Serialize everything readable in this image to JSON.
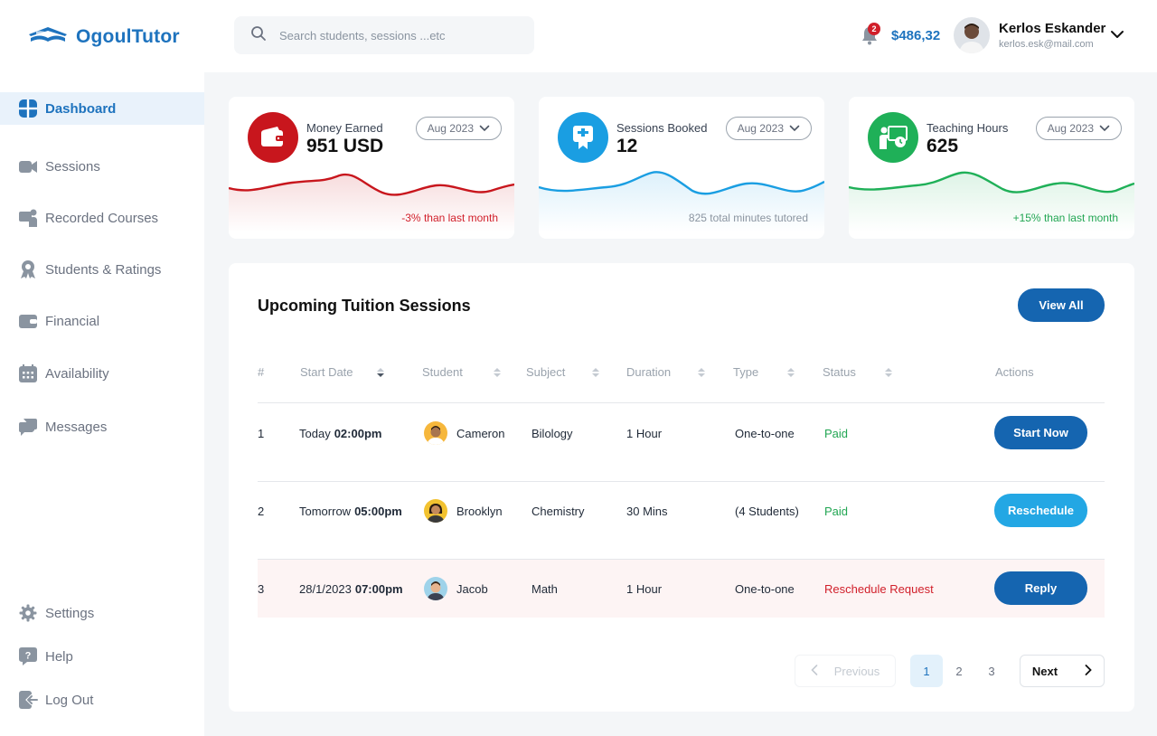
{
  "brand": {
    "name": "OgoulTutor"
  },
  "search": {
    "placeholder": "Search students, sessions ...etc"
  },
  "header": {
    "notifications_count": "2",
    "balance": "$486,32",
    "user_name": "Kerlos Eskander",
    "user_email": "kerlos.esk@mail.com"
  },
  "sidebar": {
    "items": [
      {
        "label": "Dashboard",
        "icon": "dashboard-icon",
        "active": true
      },
      {
        "label": "Sessions",
        "icon": "video-camera-icon"
      },
      {
        "label": "Recorded Courses",
        "icon": "screen-presenter-icon"
      },
      {
        "label": "Students & Ratings",
        "icon": "award-ribbon-icon"
      },
      {
        "label": "Financial",
        "icon": "wallet-icon"
      },
      {
        "label": "Availability",
        "icon": "calendar-icon"
      },
      {
        "label": "Messages",
        "icon": "chat-bubbles-icon"
      }
    ],
    "bottom": [
      {
        "label": "Settings",
        "icon": "gear-icon"
      },
      {
        "label": "Help",
        "icon": "help-icon"
      },
      {
        "label": "Log Out",
        "icon": "logout-icon"
      }
    ]
  },
  "stats": [
    {
      "label": "Money Earned",
      "value": "951 USD",
      "period": "Aug 2023",
      "note": "-3% than last month",
      "color": "#c8161d",
      "note_color": "#d11f2a"
    },
    {
      "label": "Sessions Booked",
      "value": "12",
      "period": "Aug 2023",
      "note": "825 total minutes tutored",
      "color": "#1a9ee2",
      "note_color": "#8a94a0"
    },
    {
      "label": "Teaching Hours",
      "value": "625",
      "period": "Aug 2023",
      "note": "+15% than last month",
      "color": "#1fb058",
      "note_color": "#22a653"
    }
  ],
  "sessions": {
    "title": "Upcoming Tuition Sessions",
    "view_all": "View All",
    "columns": [
      "#",
      "Start Date",
      "Student",
      "Subject",
      "Duration",
      "Type",
      "Status",
      "Actions"
    ],
    "rows": [
      {
        "num": "1",
        "date": "Today",
        "time": "02:00pm",
        "student": "Cameron",
        "subject": "Bilology",
        "duration": "1 Hour",
        "type": "One-to-one",
        "status": "Paid",
        "action": "Start Now"
      },
      {
        "num": "2",
        "date": "Tomorrow",
        "time": "05:00pm",
        "student": "Brooklyn",
        "subject": "Chemistry",
        "duration": "30 Mins",
        "type": "(4 Students)",
        "status": "Paid",
        "action": "Reschedule"
      },
      {
        "num": "3",
        "date": "28/1/2023",
        "time": "07:00pm",
        "student": "Jacob",
        "subject": "Math",
        "duration": "1 Hour",
        "type": "One-to-one",
        "status": "Reschedule Request",
        "action": "Reply"
      }
    ]
  },
  "pagination": {
    "previous": "Previous",
    "pages": [
      "1",
      "2",
      "3"
    ],
    "current": "1",
    "next": "Next"
  }
}
